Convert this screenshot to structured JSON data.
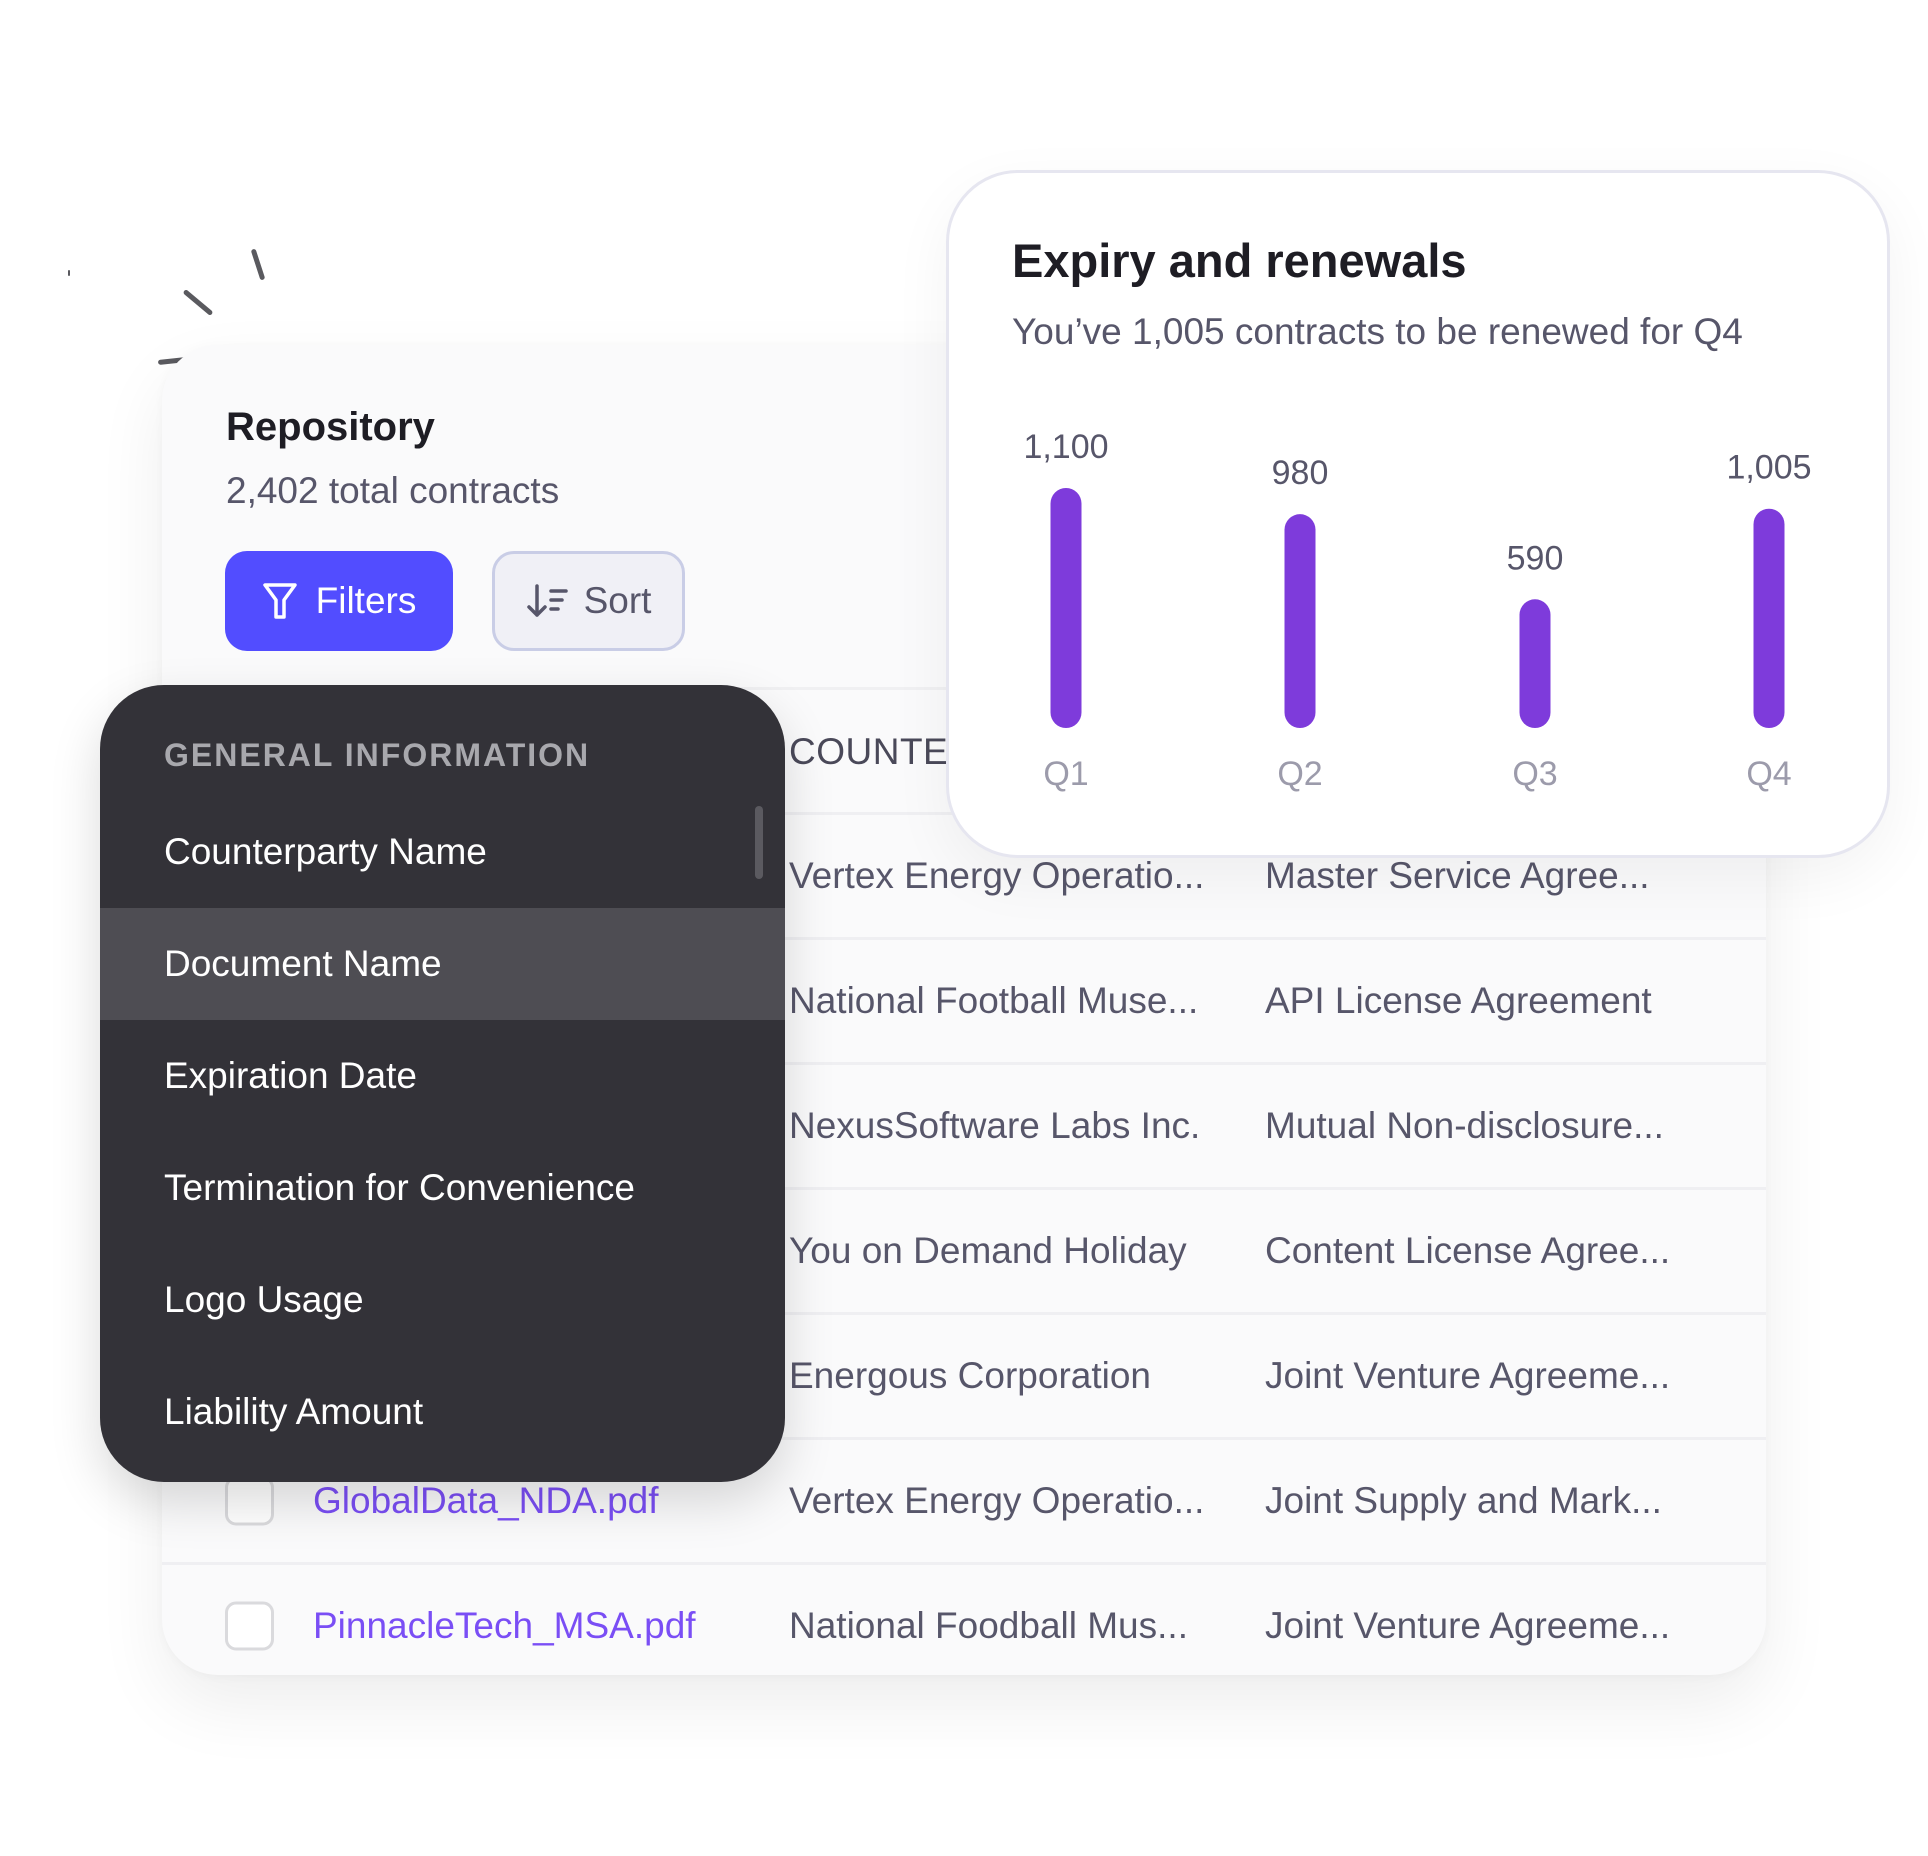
{
  "repository": {
    "title": "Repository",
    "subtitle": "2,402 total contracts",
    "filters_label": "Filters",
    "sort_label": "Sort",
    "column_counterparty": "COUNTE",
    "rows": [
      {
        "document": "",
        "counterparty": "Vertex Energy Operatio...",
        "type": "Master Service Agree..."
      },
      {
        "document": "",
        "counterparty": "National Football Muse...",
        "type": "API License Agreement"
      },
      {
        "document": "",
        "counterparty": "NexusSoftware Labs Inc.",
        "type": "Mutual Non-disclosure..."
      },
      {
        "document": "",
        "counterparty": "You on Demand Holiday",
        "type": "Content License Agree..."
      },
      {
        "document": "",
        "counterparty": "Energous Corporation",
        "type": "Joint Venture Agreeme..."
      },
      {
        "document": "GlobalData_NDA.pdf",
        "counterparty": "Vertex Energy Operatio...",
        "type": "Joint Supply and Mark..."
      },
      {
        "document": "PinnacleTech_MSA.pdf",
        "counterparty": "National Foodball Mus...",
        "type": "Joint Venture Agreeme..."
      }
    ]
  },
  "dropdown": {
    "section": "GENERAL INFORMATION",
    "items": [
      {
        "label": "Counterparty Name"
      },
      {
        "label": "Document Name",
        "active": true
      },
      {
        "label": "Expiration Date"
      },
      {
        "label": "Termination for Convenience"
      },
      {
        "label": "Logo Usage"
      },
      {
        "label": "Liability Amount"
      }
    ]
  },
  "chart": {
    "title": "Expiry and renewals",
    "subtitle": "You’ve 1,005 contracts to be renewed for Q4"
  },
  "chart_data": {
    "type": "bar",
    "title": "Expiry and renewals",
    "subtitle": "You’ve 1,005 contracts to be renewed for Q4",
    "categories": [
      "Q1",
      "Q2",
      "Q3",
      "Q4"
    ],
    "values": [
      1100,
      980,
      590,
      1005
    ],
    "value_labels": [
      "1,100",
      "980",
      "590",
      "1,005"
    ],
    "xlabel": "",
    "ylabel": "",
    "ylim": [
      0,
      1100
    ],
    "grid": false,
    "legend": "none"
  },
  "colors": {
    "accent": "#524dff",
    "bar": "#7e3bdb",
    "link": "#7a4ef5",
    "dropdown_bg": "#333238"
  },
  "icons": {
    "filter": "filter-icon",
    "sort": "sort-icon"
  }
}
